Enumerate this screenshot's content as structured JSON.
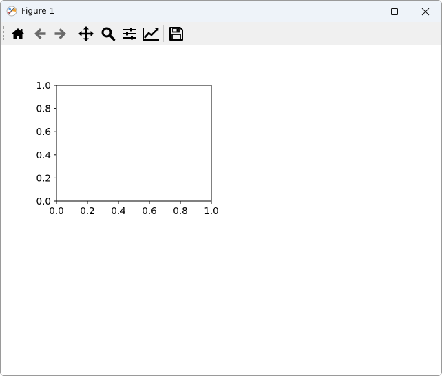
{
  "window": {
    "title": "Figure 1",
    "app_icon": "matplotlib-icon",
    "controls": [
      "minimize-icon",
      "maximize-icon",
      "close-icon"
    ]
  },
  "toolbar": {
    "tools": [
      {
        "name": "home-icon"
      },
      {
        "name": "back-arrow-icon"
      },
      {
        "name": "forward-arrow-icon"
      },
      {
        "name": "pan-move-icon"
      },
      {
        "name": "zoom-magnifier-icon"
      },
      {
        "name": "configure-subplots-icon"
      },
      {
        "name": "edit-axis-icon"
      },
      {
        "name": "save-icon"
      }
    ]
  },
  "colors": {
    "titlebar_bg": "#eef3f9",
    "toolbar_bg": "#f0f0f0",
    "icon_dark": "#000000",
    "icon_disabled": "#6a6a6a"
  },
  "chart_data": {
    "type": "line",
    "title": "",
    "xlabel": "",
    "ylabel": "",
    "xlim": [
      0.0,
      1.0
    ],
    "ylim": [
      0.0,
      1.0
    ],
    "xticks": [
      "0.0",
      "0.2",
      "0.4",
      "0.6",
      "0.8",
      "1.0"
    ],
    "yticks": [
      "0.0",
      "0.2",
      "0.4",
      "0.6",
      "0.8",
      "1.0"
    ],
    "series": [],
    "grid": false
  }
}
